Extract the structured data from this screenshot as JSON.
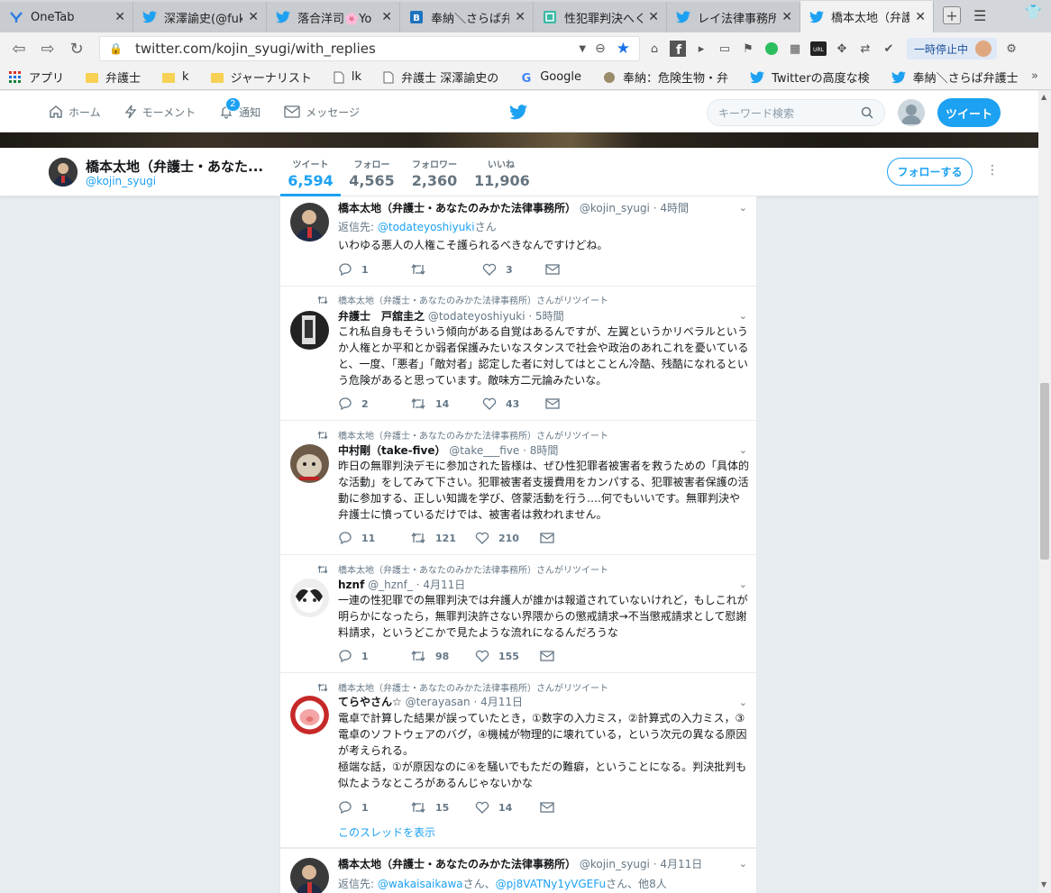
{
  "browser": {
    "tabs": [
      {
        "title": "OneTab",
        "icon": "onetab-icon"
      },
      {
        "title": "深澤諭史(@fuk",
        "icon": "twitter-icon"
      },
      {
        "title": "落合洋司🌸Yo",
        "icon": "twitter-icon"
      },
      {
        "title": "奉納＼さらば弁",
        "icon": "hatena-icon"
      },
      {
        "title": "性犯罪判決へく",
        "icon": "tab-icon"
      },
      {
        "title": "レイ法律事務所",
        "icon": "twitter-icon"
      },
      {
        "title": "橋本太地（弁護",
        "icon": "twitter-icon"
      }
    ],
    "url": "twitter.com/kojin_syugi/with_replies",
    "pause_label": "一時停止中",
    "bookmarks": [
      {
        "label": "アプリ",
        "icon": "apps-grid-icon"
      },
      {
        "label": "弁護士",
        "icon": "folder-icon"
      },
      {
        "label": "k",
        "icon": "folder-icon"
      },
      {
        "label": "ジャーナリスト",
        "icon": "folder-icon"
      },
      {
        "label": "lk",
        "icon": "page-icon"
      },
      {
        "label": "弁護士 深澤諭史の",
        "icon": "page-icon"
      },
      {
        "label": "Google",
        "icon": "google-icon"
      },
      {
        "label": "奉納：危険生物・弁",
        "icon": "hatena-icon"
      },
      {
        "label": "Twitterの高度な検",
        "icon": "twitter-icon"
      },
      {
        "label": "奉納＼さらば弁護士",
        "icon": "twitter-icon"
      }
    ]
  },
  "twitter_header": {
    "nav": [
      {
        "label": "ホーム",
        "icon": "home-icon"
      },
      {
        "label": "モーメント",
        "icon": "lightning-icon"
      },
      {
        "label": "通知",
        "icon": "bell-icon",
        "badge": "2"
      },
      {
        "label": "メッセージ",
        "icon": "mail-icon"
      }
    ],
    "search_placeholder": "キーワード検索",
    "tweet_button": "ツイート"
  },
  "profile": {
    "name": "橋本太地（弁護士・あなた...",
    "handle": "@kojin_syugi",
    "stats": [
      {
        "label": "ツイート",
        "value": "6,594",
        "active": true
      },
      {
        "label": "フォロー",
        "value": "4,565"
      },
      {
        "label": "フォロワー",
        "value": "2,360"
      },
      {
        "label": "いいね",
        "value": "11,906"
      }
    ],
    "follow_label": "フォローする"
  },
  "retweet_label": "橋本太地（弁護士・あなたのみかた法律事務所）さんがリツイート",
  "tweets": [
    {
      "name": "橋本太地（弁護士・あなたのみかた法律事務所）",
      "handle": "@kojin_syugi",
      "time": "· 4時間",
      "reply_prefix": "返信先: ",
      "reply_to": "@todateyoshiyuki",
      "reply_suffix": "さん",
      "text": "いわゆる悪人の人権こそ護られるべきなんですけどね。",
      "replies": "1",
      "retweets": "",
      "likes": "3"
    },
    {
      "name": "弁護士　戸舘圭之",
      "handle": "@todateyoshiyuki",
      "time": "· 5時間",
      "text": "これ私自身もそういう傾向がある自覚はあるんですが、左翼というかリベラルというか人権とか平和とか弱者保護みたいなスタンスで社会や政治のあれこれを憂いていると、一度、「悪者」「敵対者」認定した者に対してはとことん冷酷、残酷になれるという危険があると思っています。敵味方二元論みたいな。",
      "replies": "2",
      "retweets": "14",
      "likes": "43"
    },
    {
      "name": "中村剛（take-five）",
      "handle": "@take___five",
      "time": "· 8時間",
      "text": "昨日の無罪判決デモに参加された皆様は、ぜひ性犯罪者被害者を救うための「具体的な活動」をしてみて下さい。犯罪被害者支援費用をカンパする、犯罪被害者保護の活動に参加する、正しい知識を学び、啓蒙活動を行う….何でもいいです。無罪判決や弁護士に憤っているだけでは、被害者は救われません。",
      "replies": "11",
      "retweets": "121",
      "likes": "210"
    },
    {
      "name": "hznf",
      "handle": "@_hznf_",
      "time": "· 4月11日",
      "text": "一連の性犯罪での無罪判決では弁護人が誰かは報道されていないけれど，もしこれが明らかになったら，無罪判決許さない界隈からの懲戒請求→不当懲戒請求として慰謝料請求，というどこかで見たような流れになるんだろうな",
      "replies": "1",
      "retweets": "98",
      "likes": "155"
    },
    {
      "name": "てらやさん☆",
      "handle": "@terayasan",
      "time": "· 4月11日",
      "text": "電卓で計算した結果が誤っていたとき，①数字の入力ミス，②計算式の入力ミス，③電卓のソフトウェアのバグ，④機械が物理的に壊れている，という次元の異なる原因が考えられる。\n極端な話，①が原因なのに④を騒いでもただの難癖，ということになる。判決批判も似たようなところがあるんじゃないかな",
      "replies": "1",
      "retweets": "15",
      "likes": "14",
      "thread_link": "このスレッドを表示"
    },
    {
      "name": "橋本太地（弁護士・あなたのみかた法律事務所）",
      "handle": "@kojin_syugi",
      "time": "· 4月11日",
      "reply_prefix": "返信先: ",
      "reply_to": "@wakaisaikawa",
      "reply_mid": "さん、",
      "reply_to2": "@pj8VATNy1yVGEFu",
      "reply_suffix": "さん、他8人"
    }
  ],
  "colors": {
    "accent": "#1da1f2",
    "retweet": "#17bf63",
    "text": "#14171a",
    "muted": "#657786",
    "background": "#e6ecf0"
  }
}
